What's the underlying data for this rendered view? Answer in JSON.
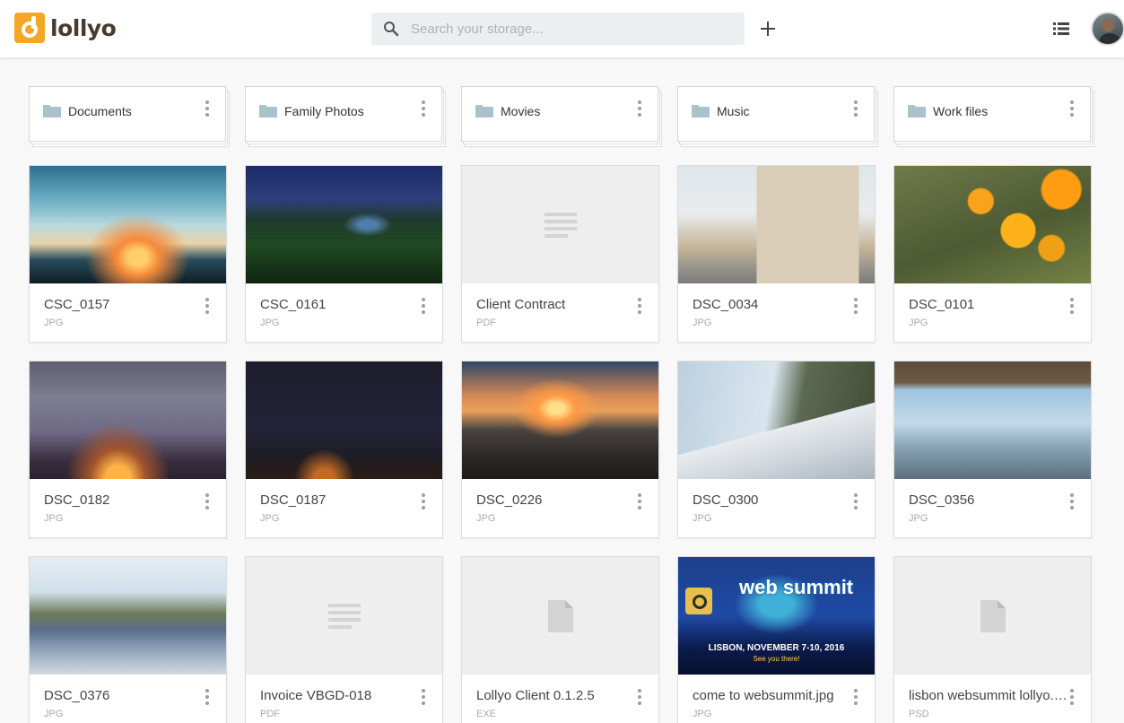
{
  "app": {
    "logo_text": "lollyo",
    "brand_color": "#f5a623"
  },
  "search": {
    "placeholder": "Search your storage..."
  },
  "toolbar": {
    "add_icon": "plus-icon",
    "view_icon": "list-view-icon",
    "avatar": "user-avatar"
  },
  "folders": [
    {
      "name": "Documents"
    },
    {
      "name": "Family Photos"
    },
    {
      "name": "Movies"
    },
    {
      "name": "Music"
    },
    {
      "name": "Work files"
    }
  ],
  "files": [
    {
      "name": "CSC_0157",
      "type": "JPG",
      "thumb": "photo"
    },
    {
      "name": "CSC_0161",
      "type": "JPG",
      "thumb": "photo"
    },
    {
      "name": "Client Contract",
      "type": "PDF",
      "thumb": "document-placeholder"
    },
    {
      "name": "DSC_0034",
      "type": "JPG",
      "thumb": "photo"
    },
    {
      "name": "DSC_0101",
      "type": "JPG",
      "thumb": "photo"
    },
    {
      "name": "DSC_0182",
      "type": "JPG",
      "thumb": "photo"
    },
    {
      "name": "DSC_0187",
      "type": "JPG",
      "thumb": "photo"
    },
    {
      "name": "DSC_0226",
      "type": "JPG",
      "thumb": "photo"
    },
    {
      "name": "DSC_0300",
      "type": "JPG",
      "thumb": "photo"
    },
    {
      "name": "DSC_0356",
      "type": "JPG",
      "thumb": "photo"
    },
    {
      "name": "DSC_0376",
      "type": "JPG",
      "thumb": "photo"
    },
    {
      "name": "Invoice VBGD-018",
      "type": "PDF",
      "thumb": "document-placeholder"
    },
    {
      "name": "Lollyo Client 0.1.2.5",
      "type": "EXE",
      "thumb": "file-placeholder"
    },
    {
      "name": "come to websummit.jpg",
      "type": "JPG",
      "thumb": "photo",
      "thumb_text": {
        "title": "web summit",
        "line1": "LISBON, NOVEMBER 7-10, 2016",
        "line2": "See you there!"
      }
    },
    {
      "name": "lisbon websummit lollyo.psd",
      "type": "PSD",
      "thumb": "file-placeholder"
    }
  ]
}
